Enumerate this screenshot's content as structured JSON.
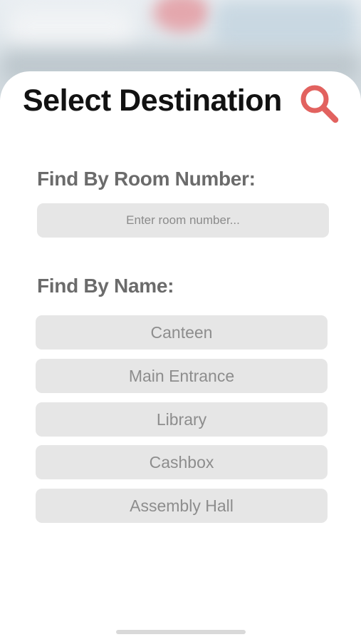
{
  "header": {
    "title": "Select Destination",
    "search_icon": "search-icon",
    "accent_color": "#e2625f"
  },
  "room_search": {
    "label": "Find By Room Number:",
    "placeholder": "Enter room number...",
    "value": ""
  },
  "name_search": {
    "label": "Find By Name:",
    "destinations": [
      {
        "label": "Canteen"
      },
      {
        "label": "Main Entrance"
      },
      {
        "label": "Library"
      },
      {
        "label": "Cashbox"
      },
      {
        "label": "Assembly Hall"
      }
    ]
  }
}
